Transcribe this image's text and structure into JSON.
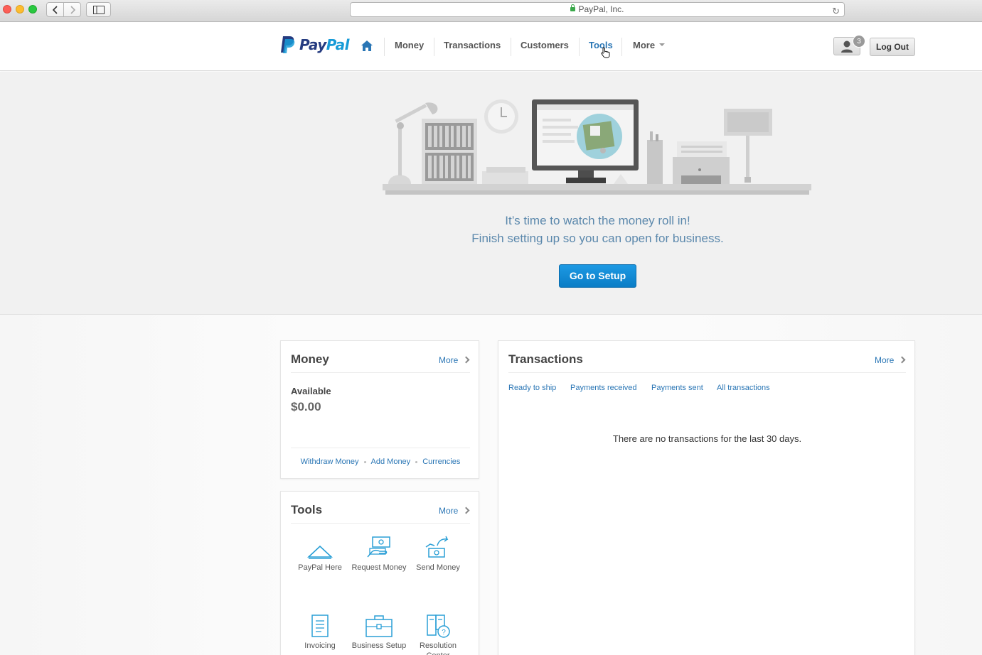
{
  "browser": {
    "url_label": "PayPal, Inc."
  },
  "header": {
    "logo_text_main": "Pay",
    "logo_text_accent": "Pal",
    "nav": [
      {
        "label": "Money"
      },
      {
        "label": "Transactions"
      },
      {
        "label": "Customers"
      },
      {
        "label": "Tools"
      },
      {
        "label": "More"
      }
    ],
    "notification_count": "3",
    "logout_label": "Log Out",
    "active_nav": "Tools"
  },
  "hero": {
    "line1": "It’s time to watch the money roll in!",
    "line2": "Finish setting up so you can open for business.",
    "button_label": "Go to Setup"
  },
  "money_card": {
    "title": "Money",
    "more_label": "More",
    "available_label": "Available",
    "available_value": "$0.00",
    "links": [
      "Withdraw Money",
      "Add Money",
      "Currencies"
    ]
  },
  "tools_card": {
    "title": "Tools",
    "more_label": "More",
    "tools": [
      {
        "label": "PayPal Here",
        "icon": "paypal-here-icon"
      },
      {
        "label": "Request Money",
        "icon": "request-money-icon"
      },
      {
        "label": "Send Money",
        "icon": "send-money-icon"
      },
      {
        "label": "Invoicing",
        "icon": "invoicing-icon"
      },
      {
        "label": "Business Setup",
        "icon": "business-setup-icon"
      },
      {
        "label": "Resolution Center",
        "icon": "resolution-center-icon"
      }
    ]
  },
  "transactions_card": {
    "title": "Transactions",
    "more_label": "More",
    "tabs": [
      "Ready to ship",
      "Payments received",
      "Payments sent",
      "All transactions"
    ],
    "empty_message": "There are no transactions for the last 30 days."
  },
  "colors": {
    "link_blue": "#2a76b5",
    "button_blue": "#0a7dc6",
    "hero_text": "#5b88ac",
    "hero_bg": "#f1f1f1"
  }
}
